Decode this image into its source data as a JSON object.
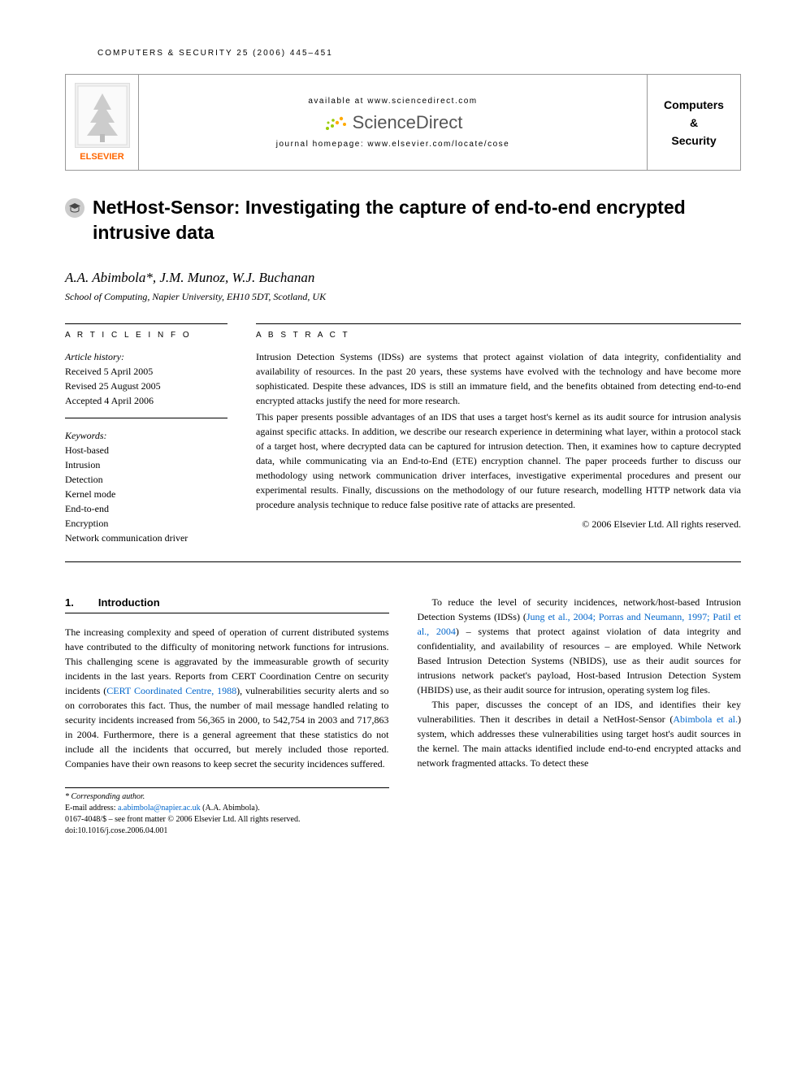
{
  "running_head": "COMPUTERS & SECURITY 25 (2006) 445–451",
  "header": {
    "available_at": "available at www.sciencedirect.com",
    "sciencedirect": "ScienceDirect",
    "homepage": "journal homepage: www.elsevier.com/locate/cose",
    "publisher": "ELSEVIER",
    "journal_name_1": "Computers",
    "journal_name_amp": "&",
    "journal_name_2": "Security"
  },
  "title": "NetHost-Sensor: Investigating the capture of end-to-end encrypted intrusive data",
  "authors": "A.A. Abimbola*, J.M. Munoz, W.J. Buchanan",
  "affiliation": "School of Computing, Napier University, EH10 5DT, Scotland, UK",
  "labels": {
    "article_info": "A R T I C L E  I N F O",
    "abstract": "A B S T R A C T"
  },
  "article_history": {
    "label": "Article history:",
    "received": "Received 5 April 2005",
    "revised": "Revised 25 August 2005",
    "accepted": "Accepted 4 April 2006"
  },
  "keywords": {
    "label": "Keywords:",
    "items": [
      "Host-based",
      "Intrusion",
      "Detection",
      "Kernel mode",
      "End-to-end",
      "Encryption",
      "Network communication driver"
    ]
  },
  "abstract": {
    "p1": "Intrusion Detection Systems (IDSs) are systems that protect against violation of data integrity, confidentiality and availability of resources. In the past 20 years, these systems have evolved with the technology and have become more sophisticated. Despite these advances, IDS is still an immature field, and the benefits obtained from detecting end-to-end encrypted attacks justify the need for more research.",
    "p2": "This paper presents possible advantages of an IDS that uses a target host's kernel as its audit source for intrusion analysis against specific attacks. In addition, we describe our research experience in determining what layer, within a protocol stack of a target host, where decrypted data can be captured for intrusion detection. Then, it examines how to capture decrypted data, while communicating via an End-to-End (ETE) encryption channel. The paper proceeds further to discuss our methodology using network communication driver interfaces, investigative experimental procedures and present our experimental results. Finally, discussions on the methodology of our future research, modelling HTTP network data via procedure analysis technique to reduce false positive rate of attacks are presented.",
    "copyright": "© 2006 Elsevier Ltd. All rights reserved."
  },
  "section1": {
    "number": "1.",
    "heading": "Introduction"
  },
  "body": {
    "col1_p1a": "The increasing complexity and speed of operation of current distributed systems have contributed to the difficulty of monitoring network functions for intrusions. This challenging scene is aggravated by the immeasurable growth of security incidents in the last years. Reports from CERT Coordination Centre on security incidents (",
    "col1_cite1": "CERT Coordinated Centre, 1988",
    "col1_p1b": "), vulnerabilities security alerts and so on corroborates this fact. Thus, the number of mail message handled relating to security incidents increased from 56,365 in 2000, to 542,754 in 2003 and 717,863 in 2004. Furthermore, there is a general agreement that these statistics do not include all the incidents that occurred, but merely included those reported. Companies have their own reasons to keep secret the security incidences suffered.",
    "col2_p1a": "To reduce the level of security incidences, network/host-based Intrusion Detection Systems (IDSs) (",
    "col2_cite1": "Jung et al., 2004; Porras and Neumann, 1997; Patil et al., 2004",
    "col2_p1b": ") – systems that protect against violation of data integrity and confidentiality, and availability of resources – are employed. While Network Based Intrusion Detection Systems (NBIDS), use as their audit sources for intrusions network packet's payload, Host-based Intrusion Detection System (HBIDS) use, as their audit source for intrusion, operating system log files.",
    "col2_p2a": "This paper, discusses the concept of an IDS, and identifies their key vulnerabilities. Then it describes in detail a NetHost-Sensor (",
    "col2_cite2": "Abimbola et al.",
    "col2_p2b": ") system, which addresses these vulnerabilities using target host's audit sources in the kernel. The main attacks identified include end-to-end encrypted attacks and network fragmented attacks. To detect these"
  },
  "footnote": {
    "corr_label": "* Corresponding author.",
    "email_label": "E-mail address: ",
    "email": "a.abimbola@napier.ac.uk",
    "email_name": " (A.A. Abimbola).",
    "line1": "0167-4048/$ – see front matter © 2006 Elsevier Ltd. All rights reserved.",
    "line2": "doi:10.1016/j.cose.2006.04.001"
  }
}
